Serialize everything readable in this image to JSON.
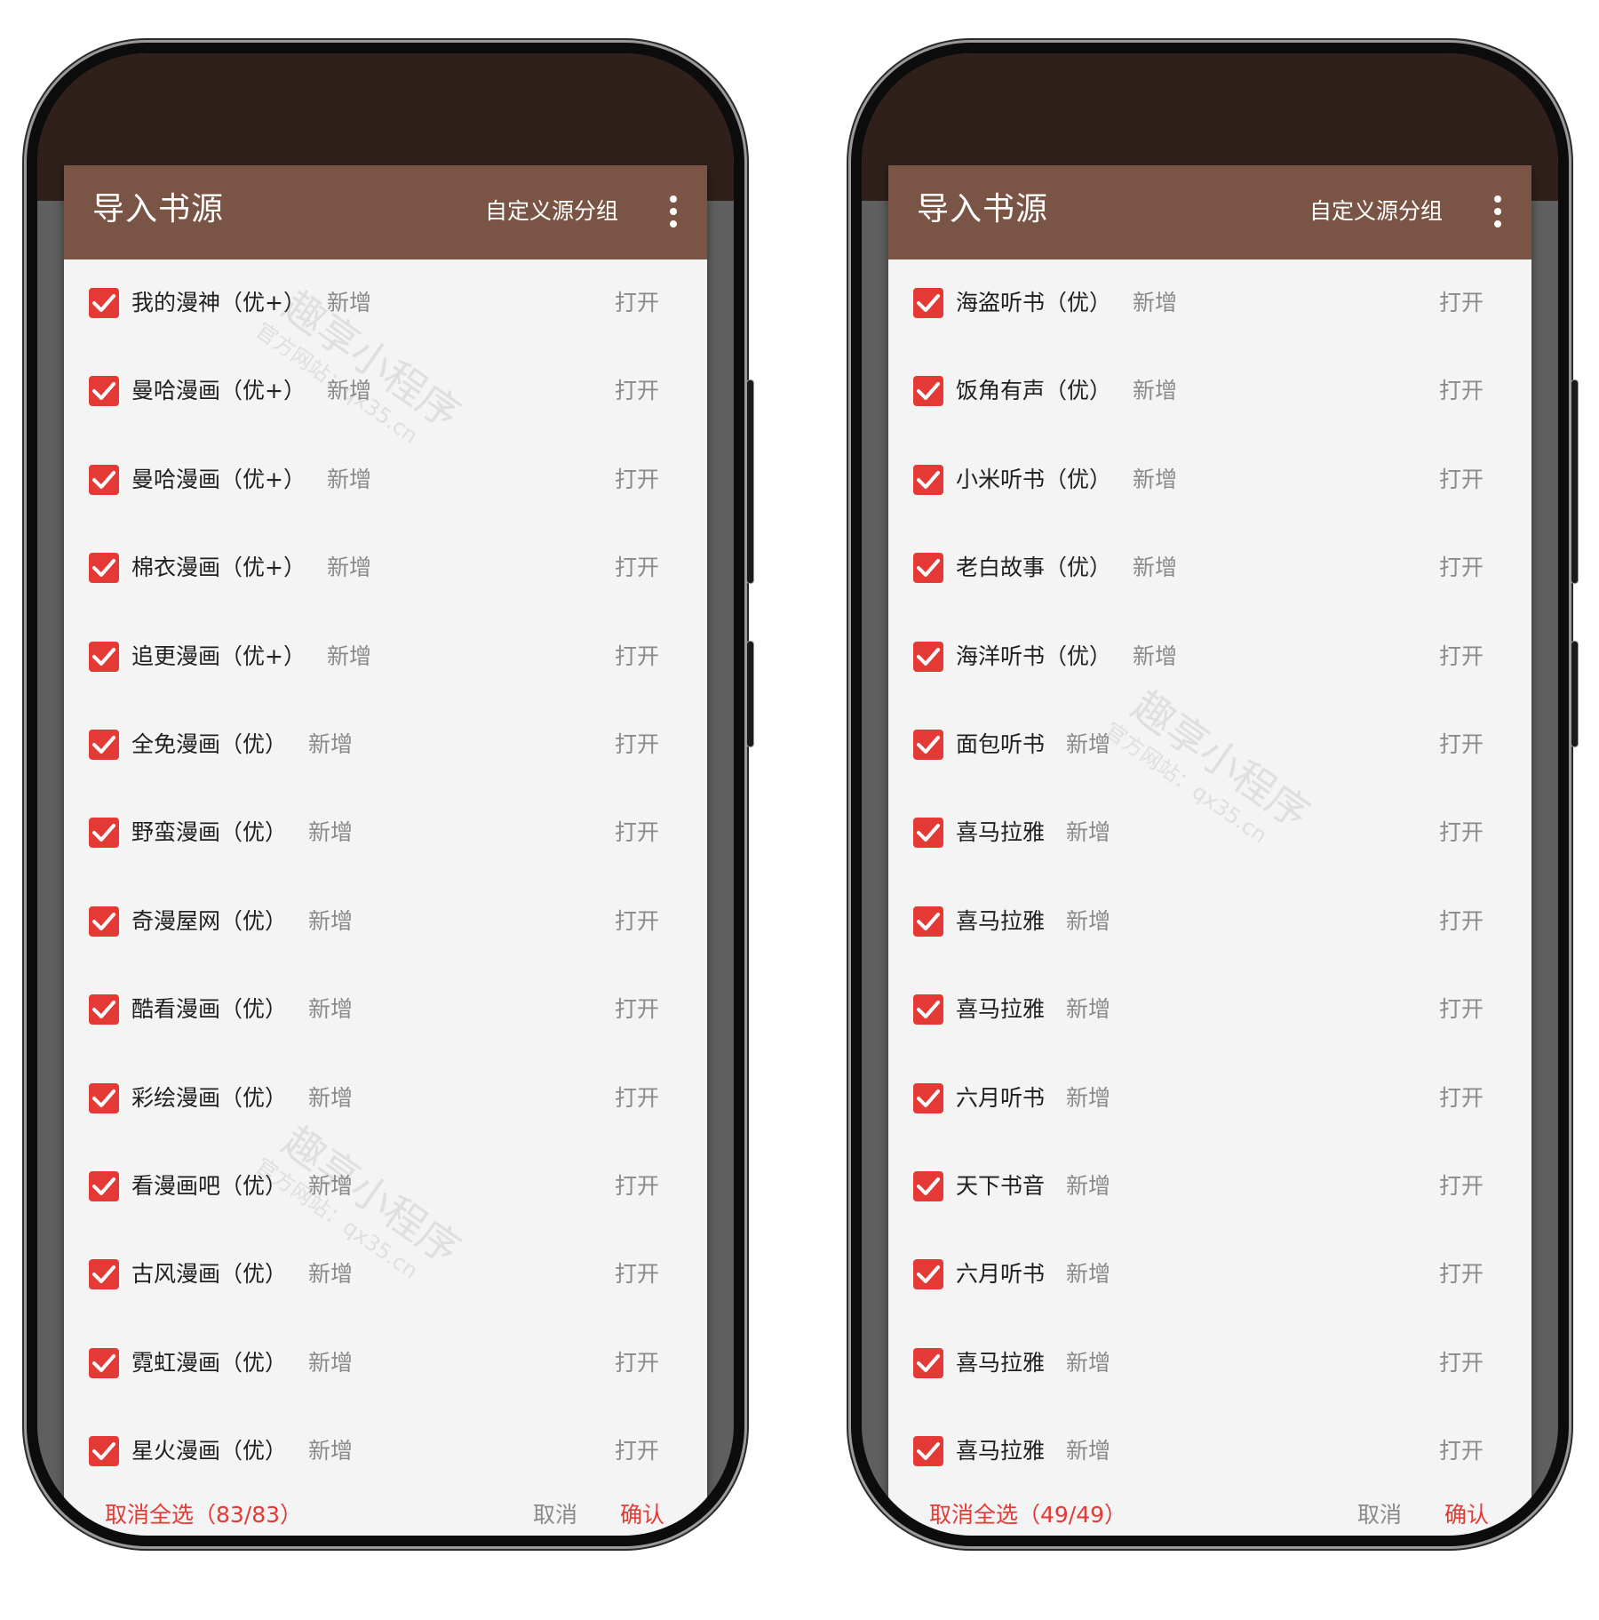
{
  "screens": [
    {
      "title": "导入书源",
      "group_label": "自定义源分组",
      "items": [
        {
          "name": "我的漫神（优+）",
          "tag": "新增",
          "open": "打开"
        },
        {
          "name": "曼哈漫画（优+）",
          "tag": "新增",
          "open": "打开"
        },
        {
          "name": "曼哈漫画（优+）",
          "tag": "新增",
          "open": "打开"
        },
        {
          "name": "棉衣漫画（优+）",
          "tag": "新增",
          "open": "打开"
        },
        {
          "name": "追更漫画（优+）",
          "tag": "新增",
          "open": "打开"
        },
        {
          "name": "全免漫画（优）",
          "tag": "新增",
          "open": "打开"
        },
        {
          "name": "野蛮漫画（优）",
          "tag": "新增",
          "open": "打开"
        },
        {
          "name": "奇漫屋网（优）",
          "tag": "新增",
          "open": "打开"
        },
        {
          "name": "酷看漫画（优）",
          "tag": "新增",
          "open": "打开"
        },
        {
          "name": "彩绘漫画（优）",
          "tag": "新增",
          "open": "打开"
        },
        {
          "name": "看漫画吧（优）",
          "tag": "新增",
          "open": "打开"
        },
        {
          "name": "古风漫画（优）",
          "tag": "新增",
          "open": "打开"
        },
        {
          "name": "霓虹漫画（优）",
          "tag": "新增",
          "open": "打开"
        },
        {
          "name": "星火漫画（优）",
          "tag": "新增",
          "open": "打开"
        }
      ],
      "footer": {
        "deselect": "取消全选（83/83）",
        "cancel": "取消",
        "confirm": "确认"
      }
    },
    {
      "title": "导入书源",
      "group_label": "自定义源分组",
      "items": [
        {
          "name": "海盗听书（优）",
          "tag": "新增",
          "open": "打开"
        },
        {
          "name": "饭角有声（优）",
          "tag": "新增",
          "open": "打开"
        },
        {
          "name": "小米听书（优）",
          "tag": "新增",
          "open": "打开"
        },
        {
          "name": "老白故事（优）",
          "tag": "新增",
          "open": "打开"
        },
        {
          "name": "海洋听书（优）",
          "tag": "新增",
          "open": "打开"
        },
        {
          "name": "面包听书",
          "tag": "新增",
          "open": "打开"
        },
        {
          "name": "喜马拉雅",
          "tag": "新增",
          "open": "打开"
        },
        {
          "name": "喜马拉雅",
          "tag": "新增",
          "open": "打开"
        },
        {
          "name": "喜马拉雅",
          "tag": "新增",
          "open": "打开"
        },
        {
          "name": "六月听书",
          "tag": "新增",
          "open": "打开"
        },
        {
          "name": "天下书音",
          "tag": "新增",
          "open": "打开"
        },
        {
          "name": "六月听书",
          "tag": "新增",
          "open": "打开"
        },
        {
          "name": "喜马拉雅",
          "tag": "新增",
          "open": "打开"
        },
        {
          "name": "喜马拉雅",
          "tag": "新增",
          "open": "打开"
        }
      ],
      "footer": {
        "deselect": "取消全选（49/49）",
        "cancel": "取消",
        "confirm": "确认"
      }
    }
  ],
  "watermark": {
    "brand": "趣享小程序",
    "site": "官方网站：qx35.cn"
  },
  "colors": {
    "toolbar": "#7a5546",
    "status_bar": "#2f201c",
    "accent": "#e53935",
    "dialog_bg": "#f4f4f4"
  }
}
